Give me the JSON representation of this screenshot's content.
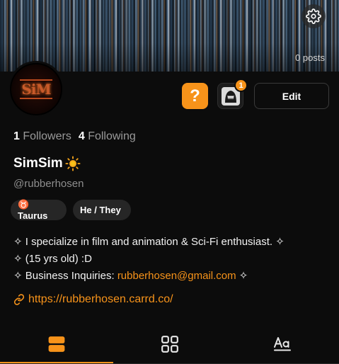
{
  "header": {
    "posts_count": "0 posts"
  },
  "profile": {
    "avatar_text": "SiM",
    "followers_count": "1",
    "followers_label": "Followers",
    "following_count": "4",
    "following_label": "Following",
    "display_name": "SimSim",
    "handle": "@rubberhosen",
    "tags": [
      {
        "label": "♉ Taurus"
      },
      {
        "label": "He / They"
      }
    ],
    "bio": {
      "line1": "✧ I specialize in film and animation & Sci-Fi enthusiast. ✧",
      "line2": "✧ (15 yrs old) :D",
      "line3_prefix": "✧ Business Inquiries: ",
      "line3_email": "rubberhosen@gmail.com",
      "line3_suffix": " ✧"
    },
    "link": "https://rubberhosen.carrd.co/"
  },
  "actions": {
    "help_label": "?",
    "notification_count": "1",
    "edit_label": "Edit"
  },
  "tabs": [
    {
      "name": "posts",
      "icon": "stacked-posts-icon",
      "active": true
    },
    {
      "name": "grid",
      "icon": "grid-icon",
      "active": false
    },
    {
      "name": "text",
      "icon": "text-aa-icon",
      "active": false
    }
  ],
  "colors": {
    "accent": "#f7931a",
    "background": "#0c0c0c",
    "chip": "#262626"
  }
}
